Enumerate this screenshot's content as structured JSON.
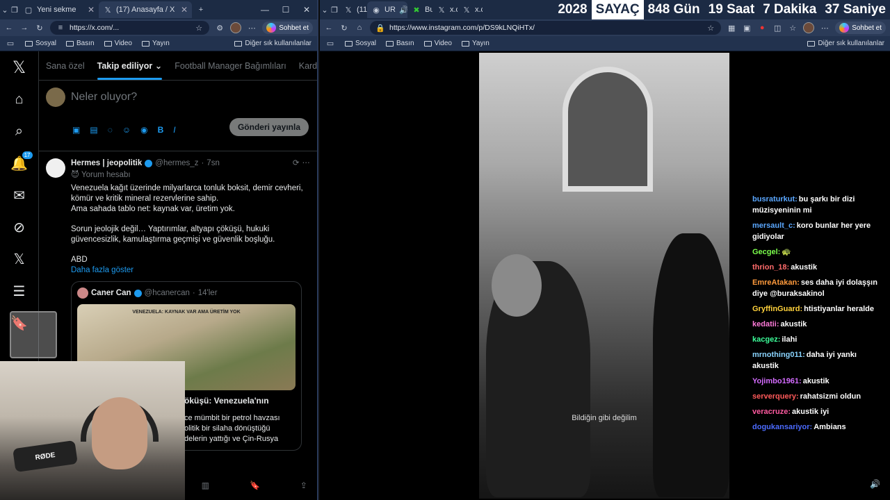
{
  "left_browser": {
    "tabs": [
      {
        "title": "Yeni sekme",
        "active": false
      },
      {
        "title": "(17) Anasayfa / X",
        "active": true
      }
    ],
    "url": "https://x.com/...",
    "copilot_label": "Sohbet et",
    "bookmarks": [
      "Sosyal",
      "Basın",
      "Video",
      "Yayın"
    ],
    "bookmarks_right": "Diğer sık kullanılanlar"
  },
  "right_browser": {
    "tabs": [
      {
        "title": "(11",
        "active": false
      },
      {
        "title": "UR",
        "active": true
      },
      {
        "title": "Bu",
        "active": false
      },
      {
        "title": "x.c",
        "active": false
      },
      {
        "title": "x.c",
        "active": false
      }
    ],
    "url": "https://www.instagram.com/p/DS9kLNQiHTx/",
    "copilot_label": "Sohbet et",
    "bookmarks": [
      "Sosyal",
      "Basın",
      "Video",
      "Yayın"
    ],
    "bookmarks_right": "Diğer sık kullanılanlar"
  },
  "counter": {
    "year": "2028",
    "label": "SAYAÇ",
    "days": "848 Gün",
    "hours": "19 Saat",
    "minutes": "7 Dakika",
    "seconds": "37 Saniye"
  },
  "x": {
    "nav_badge": "17",
    "tabs": [
      "Sana özel",
      "Takip ediliyor",
      "Football Manager Bağımlıları",
      "Karde"
    ],
    "compose_placeholder": "Neler oluyor?",
    "post_button": "Gönderi yayınla",
    "tweet": {
      "name": "Hermes | jeopolitik",
      "handle": "@hermes_z",
      "time": "7sn",
      "badge_text": "Yorum hesabı",
      "lines": [
        "Venezuela kağıt üzerinde milyarlarca tonluk boksit, demir cevheri, kömür ve kritik mineral rezervlerine sahip.",
        "Ama sahada tablo net: kaynak var, üretim yok.",
        "Sorun jeolojik değil… Yaptırımlar, altyapı çöküşü, hukuki güvencesizlik, kamulaştırma geçmişi ve güvenlik boşluğu.",
        "ABD"
      ],
      "show_more": "Daha fazla göster",
      "quote": {
        "name": "Caner Can",
        "handle": "@hcanercan",
        "time": "14'ler",
        "image_caption": "VENEZUELA: KAYNAK VAR AMA ÜRETİM YOK",
        "title_fragment": "öküşü: Venezuela'nın",
        "sub_lines": [
          "ce mümbit bir petrol havzası",
          "olitik bir silaha dönüştüğü",
          "delerin yattığı ve Çin-Rusya"
        ]
      }
    }
  },
  "instagram": {
    "subtitle": "Bildiğin gibi değilim",
    "chat": [
      {
        "user": "busraturkut:",
        "text": "bu şarkı bir dizi müzisyeninin mi",
        "color": "#5aa7ff"
      },
      {
        "user": "mersault_c:",
        "text": "koro bunlar her yere gidiyolar",
        "color": "#5aa7ff"
      },
      {
        "user": "Gecgel:",
        "text": "🐢",
        "color": "#7cff4c"
      },
      {
        "user": "thrion_18:",
        "text": "akustik",
        "color": "#ff6b6b"
      },
      {
        "user": "EmreAtakan:",
        "text": "ses daha iyi dolaşşın diye @buraksakinol",
        "color": "#ff9a3c"
      },
      {
        "user": "GryffinGuard:",
        "text": "htistiyanlar heralde",
        "color": "#ffd23c"
      },
      {
        "user": "kedatii:",
        "text": "akustik",
        "color": "#ff7ad9"
      },
      {
        "user": "kacgez:",
        "text": "ilahi",
        "color": "#3cff9a"
      },
      {
        "user": "mrnothing011:",
        "text": "daha iyi yankı akustik",
        "color": "#8ad4ff"
      },
      {
        "user": "Yojimbo1961:",
        "text": "akustik",
        "color": "#d46cff"
      },
      {
        "user": "serverquery:",
        "text": "rahatsizmi oldun",
        "color": "#ff5a5a"
      },
      {
        "user": "veracruze:",
        "text": "akustik iyi",
        "color": "#ff5aa0"
      },
      {
        "user": "dogukansariyor:",
        "text": "Ambians",
        "color": "#4c6bff"
      }
    ]
  },
  "webcam": {
    "mic_label": "RØDE"
  }
}
